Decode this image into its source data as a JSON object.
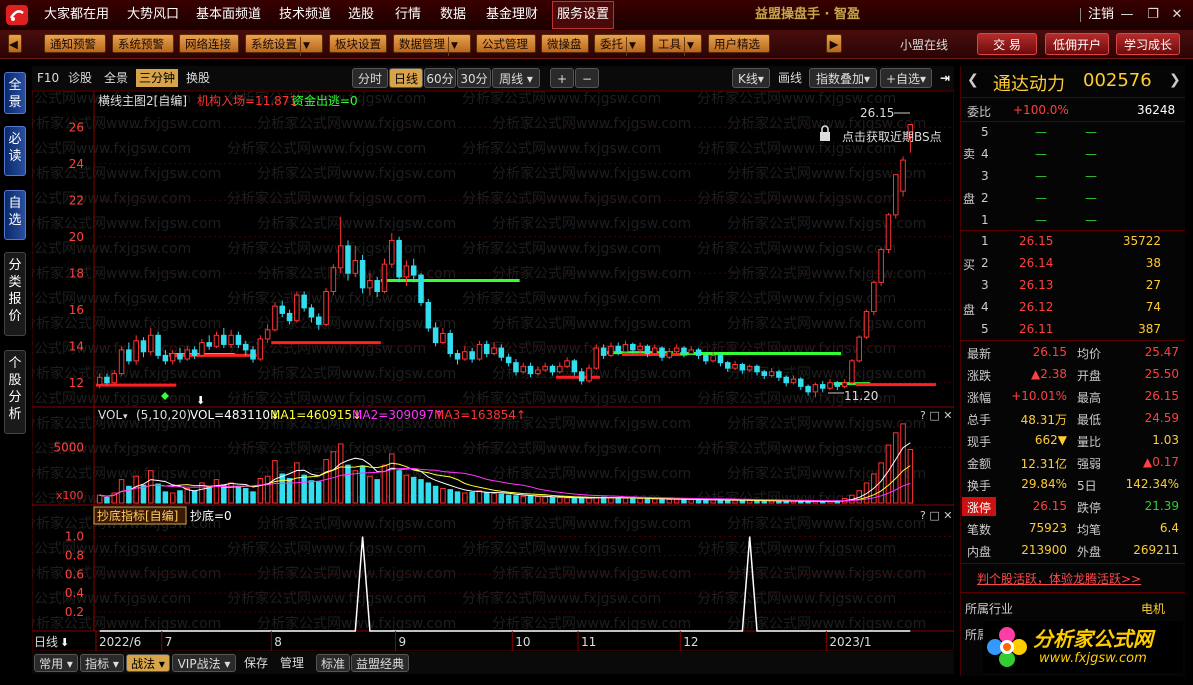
{
  "menu": {
    "items": [
      "大家都在用",
      "大势风口",
      "基本面频道",
      "技术频道",
      "选股",
      "行情",
      "数据",
      "基金理财",
      "服务设置"
    ],
    "active": "服务设置",
    "app_title": "益盟操盘手 · 智盈",
    "logout": "注销"
  },
  "toolbar": {
    "buttons": [
      "通知预警",
      "系统预警",
      "网络连接",
      "系统设置",
      "板块设置",
      "数据管理",
      "公式管理",
      "微操盘",
      "委托",
      "工具",
      "用户精选"
    ],
    "status": "小盟在线",
    "right_buttons": [
      "交 易",
      "低佣开户",
      "学习成长"
    ]
  },
  "left_tabs": [
    "全景",
    "必读",
    "自选",
    "分类报价",
    "个股分析"
  ],
  "chart_toolbar": {
    "left": [
      "F10",
      "诊股",
      "全景",
      "三分钟",
      "换股"
    ],
    "left_selected": "三分钟",
    "periods": [
      "分时",
      "日线",
      "60分",
      "30分",
      "周线"
    ],
    "period_selected": "日线",
    "right": [
      "K线",
      "画线",
      "指数叠加",
      "+自选"
    ]
  },
  "main_panel": {
    "title": "横线主图2[自编]",
    "ind1": "机构入场=11.871",
    "ind2": "资金出逃=0",
    "bs_hint": "点击获取近期BS点",
    "high_label": "26.15",
    "low_label": "11.20"
  },
  "vol_panel": {
    "name": "VOL",
    "params": "(5,10,20)",
    "vol": "VOL=483110↓",
    "ma1": "MA1=460915↓",
    "ma2": "MA2=309097↑",
    "ma3": "MA3=163854↑",
    "unit": "x100"
  },
  "ind_panel": {
    "name": "抄底指标[自编]",
    "value": "抄底=0"
  },
  "period_label": "日线",
  "bottom_bar": [
    "常用",
    "指标",
    "战法",
    "VIP战法",
    "保存",
    "管理",
    "标准",
    "益盟经典"
  ],
  "bottom_selected": "战法",
  "watermark": "分析家公式网www.fxjgsw.com",
  "colors": {
    "up": "#ff3333",
    "down": "#33ddee",
    "green_line": "#33ff33",
    "red_line": "#ff2020",
    "accent": "#d8a44a"
  },
  "stock": {
    "name": "通达动力",
    "code": "002576",
    "weibi_label": "委比",
    "weibi": "+100.0%",
    "weicha": "36248",
    "sell_label": [
      "卖",
      "盘"
    ],
    "buy_label": [
      "买",
      "盘"
    ],
    "sell": [
      {
        "level": "5",
        "price": "—",
        "vol": "—"
      },
      {
        "level": "4",
        "price": "—",
        "vol": "—"
      },
      {
        "level": "3",
        "price": "—",
        "vol": "—"
      },
      {
        "level": "2",
        "price": "—",
        "vol": "—"
      },
      {
        "level": "1",
        "price": "—",
        "vol": "—"
      }
    ],
    "buy": [
      {
        "level": "1",
        "price": "26.15",
        "vol": "35722"
      },
      {
        "level": "2",
        "price": "26.14",
        "vol": "38"
      },
      {
        "level": "3",
        "price": "26.13",
        "vol": "27"
      },
      {
        "level": "4",
        "price": "26.12",
        "vol": "74"
      },
      {
        "level": "5",
        "price": "26.11",
        "vol": "387"
      }
    ],
    "quote": [
      [
        "最新",
        "26.15",
        "均价",
        "25.47"
      ],
      [
        "涨跌",
        "▲2.38",
        "开盘",
        "25.50"
      ],
      [
        "涨幅",
        "+10.01%",
        "最高",
        "26.15"
      ],
      [
        "总手",
        "48.31万",
        "最低",
        "24.59"
      ],
      [
        "现手",
        "662▼",
        "量比",
        "1.03"
      ],
      [
        "金额",
        "12.31亿",
        "强弱",
        "▲0.17"
      ],
      [
        "换手",
        "29.84%",
        "5日",
        "142.34%"
      ],
      [
        "涨停",
        "26.15",
        "跌停",
        "21.39"
      ],
      [
        "笔数",
        "75923",
        "均笔",
        "6.4"
      ],
      [
        "内盘",
        "213900",
        "外盘",
        "269211"
      ]
    ],
    "promo": "判个股活跃，体验龙腾活跃>>",
    "industry_label": "所属行业",
    "industry": "电机",
    "next_label": "所属"
  },
  "brand": {
    "title": "分析家公式网",
    "url": "www.fxjgsw.com"
  },
  "chart_data": {
    "type": "candlestick",
    "title": "横线主图2[自编]",
    "x_ticks": [
      "2022/6",
      "7",
      "8",
      "9",
      "10",
      "11",
      "12",
      "2023/1"
    ],
    "ylim": [
      11,
      27
    ],
    "y_ticks": [
      12,
      14,
      16,
      18,
      20,
      22,
      24,
      26
    ],
    "annotations": {
      "high": 26.15,
      "low": 11.2
    },
    "candles": [
      {
        "o": 11.9,
        "c": 12.3,
        "h": 12.5,
        "l": 11.7
      },
      {
        "o": 12.3,
        "c": 12.0,
        "h": 12.5,
        "l": 11.9
      },
      {
        "o": 12.0,
        "c": 12.5,
        "h": 12.7,
        "l": 11.9
      },
      {
        "o": 12.5,
        "c": 13.8,
        "h": 14.0,
        "l": 12.4
      },
      {
        "o": 13.8,
        "c": 13.2,
        "h": 14.2,
        "l": 13.0
      },
      {
        "o": 13.2,
        "c": 14.3,
        "h": 14.6,
        "l": 13.0
      },
      {
        "o": 14.3,
        "c": 13.7,
        "h": 14.5,
        "l": 13.4
      },
      {
        "o": 13.7,
        "c": 14.6,
        "h": 15.0,
        "l": 13.5
      },
      {
        "o": 14.6,
        "c": 13.5,
        "h": 14.8,
        "l": 13.3
      },
      {
        "o": 13.5,
        "c": 13.2,
        "h": 13.8,
        "l": 13.0
      },
      {
        "o": 13.2,
        "c": 13.6,
        "h": 13.8,
        "l": 13.0
      },
      {
        "o": 13.6,
        "c": 13.3,
        "h": 13.9,
        "l": 13.1
      },
      {
        "o": 13.3,
        "c": 13.8,
        "h": 14.0,
        "l": 13.2
      },
      {
        "o": 13.8,
        "c": 13.5,
        "h": 14.0,
        "l": 13.3
      },
      {
        "o": 13.5,
        "c": 14.2,
        "h": 14.4,
        "l": 13.4
      },
      {
        "o": 14.2,
        "c": 14.0,
        "h": 14.6,
        "l": 13.8
      },
      {
        "o": 14.0,
        "c": 14.6,
        "h": 14.8,
        "l": 13.9
      },
      {
        "o": 14.6,
        "c": 14.1,
        "h": 15.0,
        "l": 13.9
      },
      {
        "o": 14.1,
        "c": 14.6,
        "h": 14.9,
        "l": 13.9
      },
      {
        "o": 14.6,
        "c": 14.1,
        "h": 14.8,
        "l": 13.9
      },
      {
        "o": 14.1,
        "c": 13.8,
        "h": 14.3,
        "l": 13.5
      },
      {
        "o": 13.8,
        "c": 13.3,
        "h": 14.0,
        "l": 13.1
      },
      {
        "o": 13.3,
        "c": 14.4,
        "h": 14.6,
        "l": 13.2
      },
      {
        "o": 14.4,
        "c": 14.9,
        "h": 15.2,
        "l": 14.2
      },
      {
        "o": 14.9,
        "c": 16.2,
        "h": 16.4,
        "l": 14.8
      },
      {
        "o": 16.2,
        "c": 15.8,
        "h": 16.5,
        "l": 15.6
      },
      {
        "o": 15.8,
        "c": 15.4,
        "h": 16.0,
        "l": 15.2
      },
      {
        "o": 15.4,
        "c": 16.8,
        "h": 17.0,
        "l": 15.3
      },
      {
        "o": 16.8,
        "c": 16.1,
        "h": 17.0,
        "l": 15.9
      },
      {
        "o": 16.1,
        "c": 15.6,
        "h": 16.3,
        "l": 15.3
      },
      {
        "o": 15.6,
        "c": 15.2,
        "h": 15.8,
        "l": 14.9
      },
      {
        "o": 15.2,
        "c": 17.0,
        "h": 17.2,
        "l": 15.1
      },
      {
        "o": 17.0,
        "c": 18.3,
        "h": 18.5,
        "l": 16.8
      },
      {
        "o": 18.3,
        "c": 19.5,
        "h": 21.1,
        "l": 18.0
      },
      {
        "o": 19.5,
        "c": 18.0,
        "h": 19.8,
        "l": 17.6
      },
      {
        "o": 18.0,
        "c": 18.7,
        "h": 19.5,
        "l": 17.8
      },
      {
        "o": 18.7,
        "c": 17.2,
        "h": 19.0,
        "l": 16.9
      },
      {
        "o": 17.2,
        "c": 17.6,
        "h": 18.0,
        "l": 16.8
      },
      {
        "o": 17.6,
        "c": 17.0,
        "h": 17.8,
        "l": 16.7
      },
      {
        "o": 17.0,
        "c": 18.5,
        "h": 18.8,
        "l": 16.9
      },
      {
        "o": 18.5,
        "c": 19.8,
        "h": 20.2,
        "l": 18.3
      },
      {
        "o": 19.8,
        "c": 17.8,
        "h": 20.0,
        "l": 17.5
      },
      {
        "o": 17.8,
        "c": 18.4,
        "h": 18.7,
        "l": 17.3
      },
      {
        "o": 18.4,
        "c": 17.9,
        "h": 18.8,
        "l": 17.5
      },
      {
        "o": 17.9,
        "c": 16.4,
        "h": 18.0,
        "l": 16.2
      },
      {
        "o": 16.4,
        "c": 15.0,
        "h": 16.6,
        "l": 14.8
      },
      {
        "o": 15.0,
        "c": 14.2,
        "h": 15.3,
        "l": 14.0
      },
      {
        "o": 14.2,
        "c": 14.7,
        "h": 15.0,
        "l": 14.1
      },
      {
        "o": 14.7,
        "c": 13.6,
        "h": 14.9,
        "l": 13.4
      },
      {
        "o": 13.6,
        "c": 13.3,
        "h": 13.8,
        "l": 13.0
      },
      {
        "o": 13.3,
        "c": 13.7,
        "h": 14.0,
        "l": 13.2
      },
      {
        "o": 13.7,
        "c": 13.3,
        "h": 13.9,
        "l": 13.1
      },
      {
        "o": 13.3,
        "c": 14.1,
        "h": 14.3,
        "l": 13.2
      },
      {
        "o": 14.1,
        "c": 13.6,
        "h": 14.3,
        "l": 13.4
      },
      {
        "o": 13.6,
        "c": 13.9,
        "h": 14.2,
        "l": 13.5
      },
      {
        "o": 13.9,
        "c": 13.4,
        "h": 14.1,
        "l": 13.2
      },
      {
        "o": 13.4,
        "c": 13.1,
        "h": 13.6,
        "l": 12.9
      },
      {
        "o": 13.1,
        "c": 12.6,
        "h": 13.3,
        "l": 12.4
      },
      {
        "o": 12.6,
        "c": 12.9,
        "h": 13.1,
        "l": 12.5
      },
      {
        "o": 12.9,
        "c": 12.5,
        "h": 13.1,
        "l": 12.3
      },
      {
        "o": 12.5,
        "c": 12.7,
        "h": 12.9,
        "l": 12.4
      },
      {
        "o": 12.7,
        "c": 12.9,
        "h": 13.1,
        "l": 12.6
      },
      {
        "o": 12.9,
        "c": 12.6,
        "h": 13.0,
        "l": 12.4
      },
      {
        "o": 12.6,
        "c": 12.9,
        "h": 13.1,
        "l": 12.5
      },
      {
        "o": 12.9,
        "c": 13.2,
        "h": 13.4,
        "l": 12.8
      },
      {
        "o": 13.2,
        "c": 12.6,
        "h": 13.3,
        "l": 12.4
      },
      {
        "o": 12.6,
        "c": 12.1,
        "h": 12.8,
        "l": 11.9
      },
      {
        "o": 12.1,
        "c": 12.8,
        "h": 13.0,
        "l": 12.0
      },
      {
        "o": 12.8,
        "c": 13.9,
        "h": 14.1,
        "l": 12.7
      },
      {
        "o": 13.9,
        "c": 13.5,
        "h": 14.1,
        "l": 13.3
      },
      {
        "o": 13.5,
        "c": 14.0,
        "h": 14.2,
        "l": 13.4
      },
      {
        "o": 14.0,
        "c": 13.7,
        "h": 14.2,
        "l": 13.5
      },
      {
        "o": 13.7,
        "c": 14.1,
        "h": 14.3,
        "l": 13.6
      },
      {
        "o": 14.1,
        "c": 13.8,
        "h": 14.2,
        "l": 13.6
      },
      {
        "o": 13.8,
        "c": 14.0,
        "h": 14.2,
        "l": 13.6
      },
      {
        "o": 14.0,
        "c": 13.6,
        "h": 14.1,
        "l": 13.4
      },
      {
        "o": 13.6,
        "c": 13.9,
        "h": 14.1,
        "l": 13.5
      },
      {
        "o": 13.9,
        "c": 13.4,
        "h": 14.0,
        "l": 13.2
      },
      {
        "o": 13.4,
        "c": 13.7,
        "h": 13.9,
        "l": 13.3
      },
      {
        "o": 13.7,
        "c": 13.9,
        "h": 14.1,
        "l": 13.6
      },
      {
        "o": 13.9,
        "c": 13.6,
        "h": 14.0,
        "l": 13.4
      },
      {
        "o": 13.6,
        "c": 13.8,
        "h": 14.0,
        "l": 13.5
      },
      {
        "o": 13.8,
        "c": 13.5,
        "h": 13.9,
        "l": 13.3
      },
      {
        "o": 13.5,
        "c": 13.2,
        "h": 13.6,
        "l": 13.0
      },
      {
        "o": 13.2,
        "c": 13.5,
        "h": 13.7,
        "l": 13.1
      },
      {
        "o": 13.5,
        "c": 13.1,
        "h": 13.6,
        "l": 12.9
      },
      {
        "o": 13.1,
        "c": 12.8,
        "h": 13.2,
        "l": 12.6
      },
      {
        "o": 12.8,
        "c": 13.0,
        "h": 13.2,
        "l": 12.7
      },
      {
        "o": 13.0,
        "c": 12.7,
        "h": 13.1,
        "l": 12.5
      },
      {
        "o": 12.7,
        "c": 12.9,
        "h": 13.0,
        "l": 12.6
      },
      {
        "o": 12.9,
        "c": 12.6,
        "h": 13.0,
        "l": 12.4
      },
      {
        "o": 12.6,
        "c": 12.4,
        "h": 12.7,
        "l": 12.2
      },
      {
        "o": 12.4,
        "c": 12.6,
        "h": 12.8,
        "l": 12.3
      },
      {
        "o": 12.6,
        "c": 12.3,
        "h": 12.7,
        "l": 12.1
      },
      {
        "o": 12.3,
        "c": 12.0,
        "h": 12.4,
        "l": 11.8
      },
      {
        "o": 12.0,
        "c": 12.2,
        "h": 12.4,
        "l": 11.9
      },
      {
        "o": 12.2,
        "c": 11.8,
        "h": 12.3,
        "l": 11.6
      },
      {
        "o": 11.8,
        "c": 11.5,
        "h": 11.9,
        "l": 11.3
      },
      {
        "o": 11.5,
        "c": 11.9,
        "h": 12.0,
        "l": 11.2
      },
      {
        "o": 11.9,
        "c": 11.7,
        "h": 12.1,
        "l": 11.5
      },
      {
        "o": 11.7,
        "c": 12.0,
        "h": 12.2,
        "l": 11.6
      },
      {
        "o": 12.0,
        "c": 11.8,
        "h": 12.1,
        "l": 11.6
      },
      {
        "o": 11.8,
        "c": 12.0,
        "h": 12.2,
        "l": 11.7
      },
      {
        "o": 12.0,
        "c": 13.2,
        "h": 13.3,
        "l": 11.9
      },
      {
        "o": 13.2,
        "c": 14.5,
        "h": 14.6,
        "l": 13.1
      },
      {
        "o": 14.5,
        "c": 15.9,
        "h": 16.0,
        "l": 14.4
      },
      {
        "o": 15.9,
        "c": 17.5,
        "h": 17.6,
        "l": 15.7
      },
      {
        "o": 17.5,
        "c": 19.3,
        "h": 19.4,
        "l": 17.3
      },
      {
        "o": 19.3,
        "c": 21.2,
        "h": 21.3,
        "l": 19.1
      },
      {
        "o": 21.2,
        "c": 23.4,
        "h": 23.4,
        "l": 21.0
      },
      {
        "o": 22.5,
        "c": 24.2,
        "h": 24.4,
        "l": 22.2
      },
      {
        "o": 25.5,
        "c": 26.15,
        "h": 26.15,
        "l": 24.6
      }
    ],
    "volume": {
      "ylim": [
        0,
        7000
      ],
      "y_ticks": [
        5000
      ],
      "values": [
        700,
        500,
        900,
        2100,
        1500,
        2400,
        1600,
        2900,
        1700,
        1000,
        900,
        1100,
        1300,
        1100,
        1800,
        1500,
        2100,
        1600,
        1800,
        1500,
        1300,
        1000,
        2200,
        2400,
        3800,
        2600,
        2200,
        3600,
        2500,
        2000,
        1900,
        3900,
        4600,
        5300,
        3400,
        2900,
        3300,
        2400,
        2100,
        3400,
        4400,
        2900,
        2500,
        2300,
        2100,
        1800,
        1500,
        1300,
        1200,
        1000,
        900,
        950,
        1100,
        900,
        850,
        800,
        700,
        650,
        600,
        620,
        580,
        540,
        500,
        480,
        460,
        450,
        480,
        420,
        460,
        520,
        480,
        460,
        430,
        420,
        400,
        380,
        360,
        340,
        320,
        330,
        310,
        300,
        290,
        280,
        270,
        260,
        250,
        240,
        230,
        220,
        210,
        200,
        190,
        180,
        170,
        160,
        150,
        140,
        150,
        140,
        130,
        200,
        400,
        700,
        1100,
        1800,
        2600,
        3600,
        5200,
        6300,
        7100,
        4800
      ],
      "ma_colors": [
        "#ffffff",
        "#ffff33",
        "#ff33ff"
      ]
    },
    "indicator": {
      "name": "抄底",
      "ylim": [
        0,
        1.1
      ],
      "y_ticks": [
        0.2,
        0.4,
        0.6,
        0.8,
        1.0
      ],
      "signals": [
        36,
        89
      ]
    },
    "level_lines": [
      {
        "color": "red",
        "value": 11.87,
        "from": 0,
        "to": 10
      },
      {
        "color": "green",
        "value": 13.55,
        "from": 10,
        "to": 18
      },
      {
        "color": "red",
        "value": 13.5,
        "from": 10,
        "to": 21
      },
      {
        "color": "red",
        "value": 14.2,
        "from": 24,
        "to": 38
      },
      {
        "color": "green",
        "value": 17.6,
        "from": 39,
        "to": 57
      },
      {
        "color": "red",
        "value": 12.3,
        "from": 63,
        "to": 68
      },
      {
        "color": "green",
        "value": 13.65,
        "from": 70,
        "to": 78
      },
      {
        "color": "red",
        "value": 13.55,
        "from": 72,
        "to": 80
      },
      {
        "color": "green",
        "value": 13.6,
        "from": 80,
        "to": 101
      },
      {
        "color": "green",
        "value": 11.95,
        "from": 101,
        "to": 105
      },
      {
        "color": "red",
        "value": 11.9,
        "from": 104,
        "to": 114
      }
    ]
  }
}
